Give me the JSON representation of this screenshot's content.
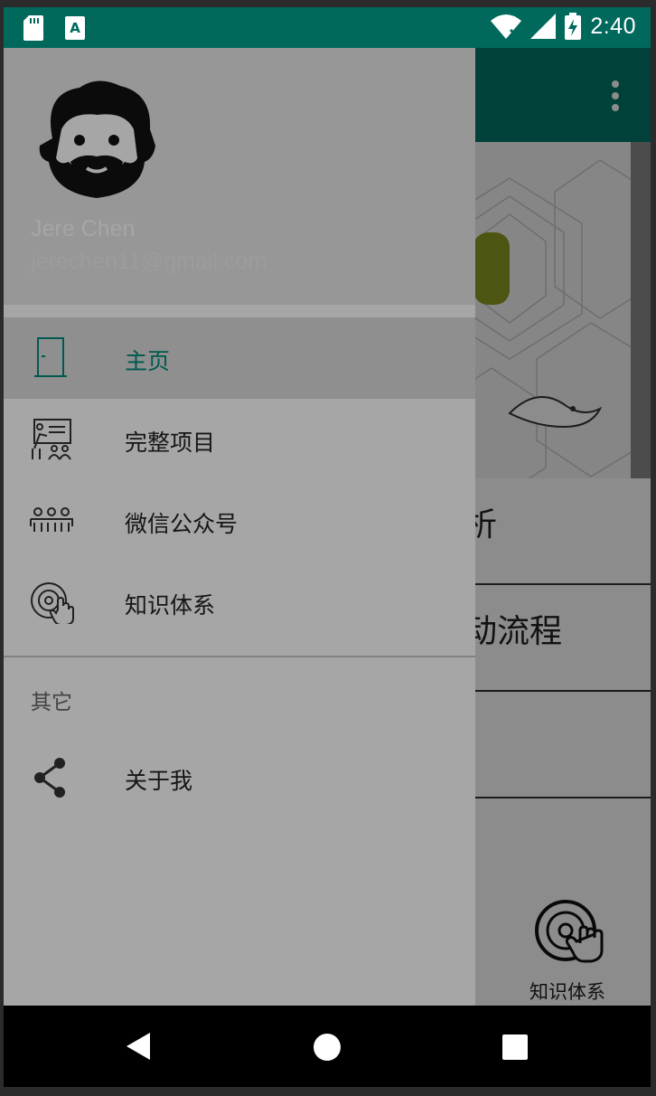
{
  "status_bar": {
    "time": "2:40",
    "left_icons": [
      "sd-card-icon",
      "text-a-icon"
    ],
    "right_icons": [
      "wifi-icon",
      "signal-icon",
      "battery-charging-icon"
    ]
  },
  "drawer": {
    "user": {
      "name": "Jere Chen",
      "email": "jerechen11@gmail.com"
    },
    "items": [
      {
        "label": "主页",
        "icon": "door-icon",
        "active": true
      },
      {
        "label": "完整项目",
        "icon": "presentation-icon",
        "active": false
      },
      {
        "label": "微信公众号",
        "icon": "group-icon",
        "active": false
      },
      {
        "label": "知识体系",
        "icon": "disc-hand-icon",
        "active": false
      }
    ],
    "section_other": "其它",
    "other_items": [
      {
        "label": "关于我",
        "icon": "share-icon"
      }
    ]
  },
  "background": {
    "list_items": [
      "析",
      "动流程",
      ""
    ],
    "fab_label": "知识体系"
  },
  "colors": {
    "primary": "#00796b",
    "primary_dark": "#00695c",
    "accent": "#00897b"
  }
}
